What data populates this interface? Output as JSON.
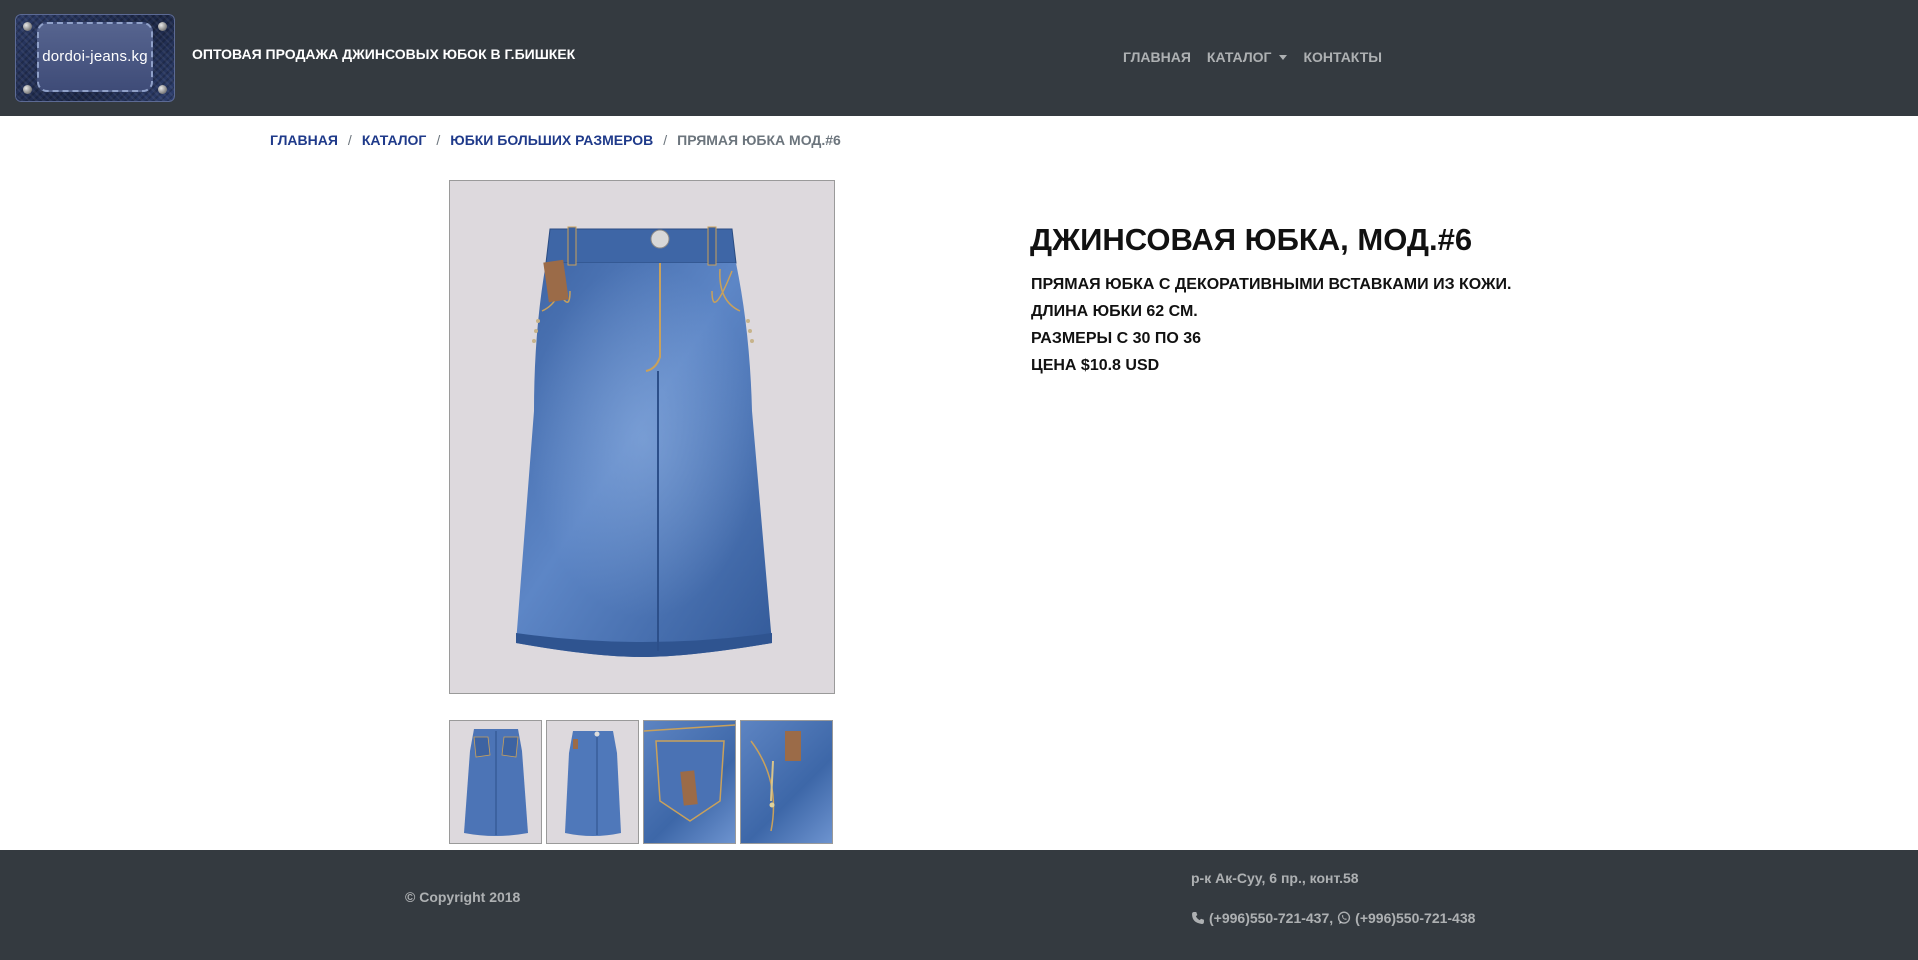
{
  "header": {
    "logo_text": "dordoi-jeans.kg",
    "brand_title": "ОПТОВАЯ ПРОДАЖА ДЖИНСОВЫХ ЮБОК В Г.БИШКЕК",
    "nav": {
      "home": "ГЛАВНАЯ",
      "catalog": "КАТАЛОГ",
      "contacts": "КОНТАКТЫ"
    }
  },
  "breadcrumb": {
    "items": [
      "ГЛАВНАЯ",
      "КАТАЛОГ",
      "ЮБКИ БОЛЬШИХ РАЗМЕРОВ"
    ],
    "current": "ПРЯМАЯ ЮБКА МОД.#6",
    "separator": "/"
  },
  "product": {
    "title": "ДЖИНСОВАЯ ЮБКА, МОД.#6",
    "description": [
      "ПРЯМАЯ ЮБКА С ДЕКОРАТИВНЫМИ ВСТАВКАМИ ИЗ КОЖИ.",
      "ДЛИНА ЮБКИ 62 СМ.",
      "РАЗМЕРЫ С 30 ПО 36",
      "ЦЕНА $10.8 USD"
    ]
  },
  "footer": {
    "copyright": "© Copyright 2018",
    "address": "р-к Ак-Суу, 6 пр., конт.58",
    "phone1": "(+996)550-721-437,",
    "phone2": "(+996)550-721-438"
  },
  "icons": {
    "phone": "phone-icon",
    "whatsapp": "whatsapp-icon",
    "caret": "caret-down-icon"
  },
  "colors": {
    "navbar": "#343a40",
    "link": "#1f3a8a",
    "muted": "#6c757d",
    "denim": "#3f6aaa"
  }
}
